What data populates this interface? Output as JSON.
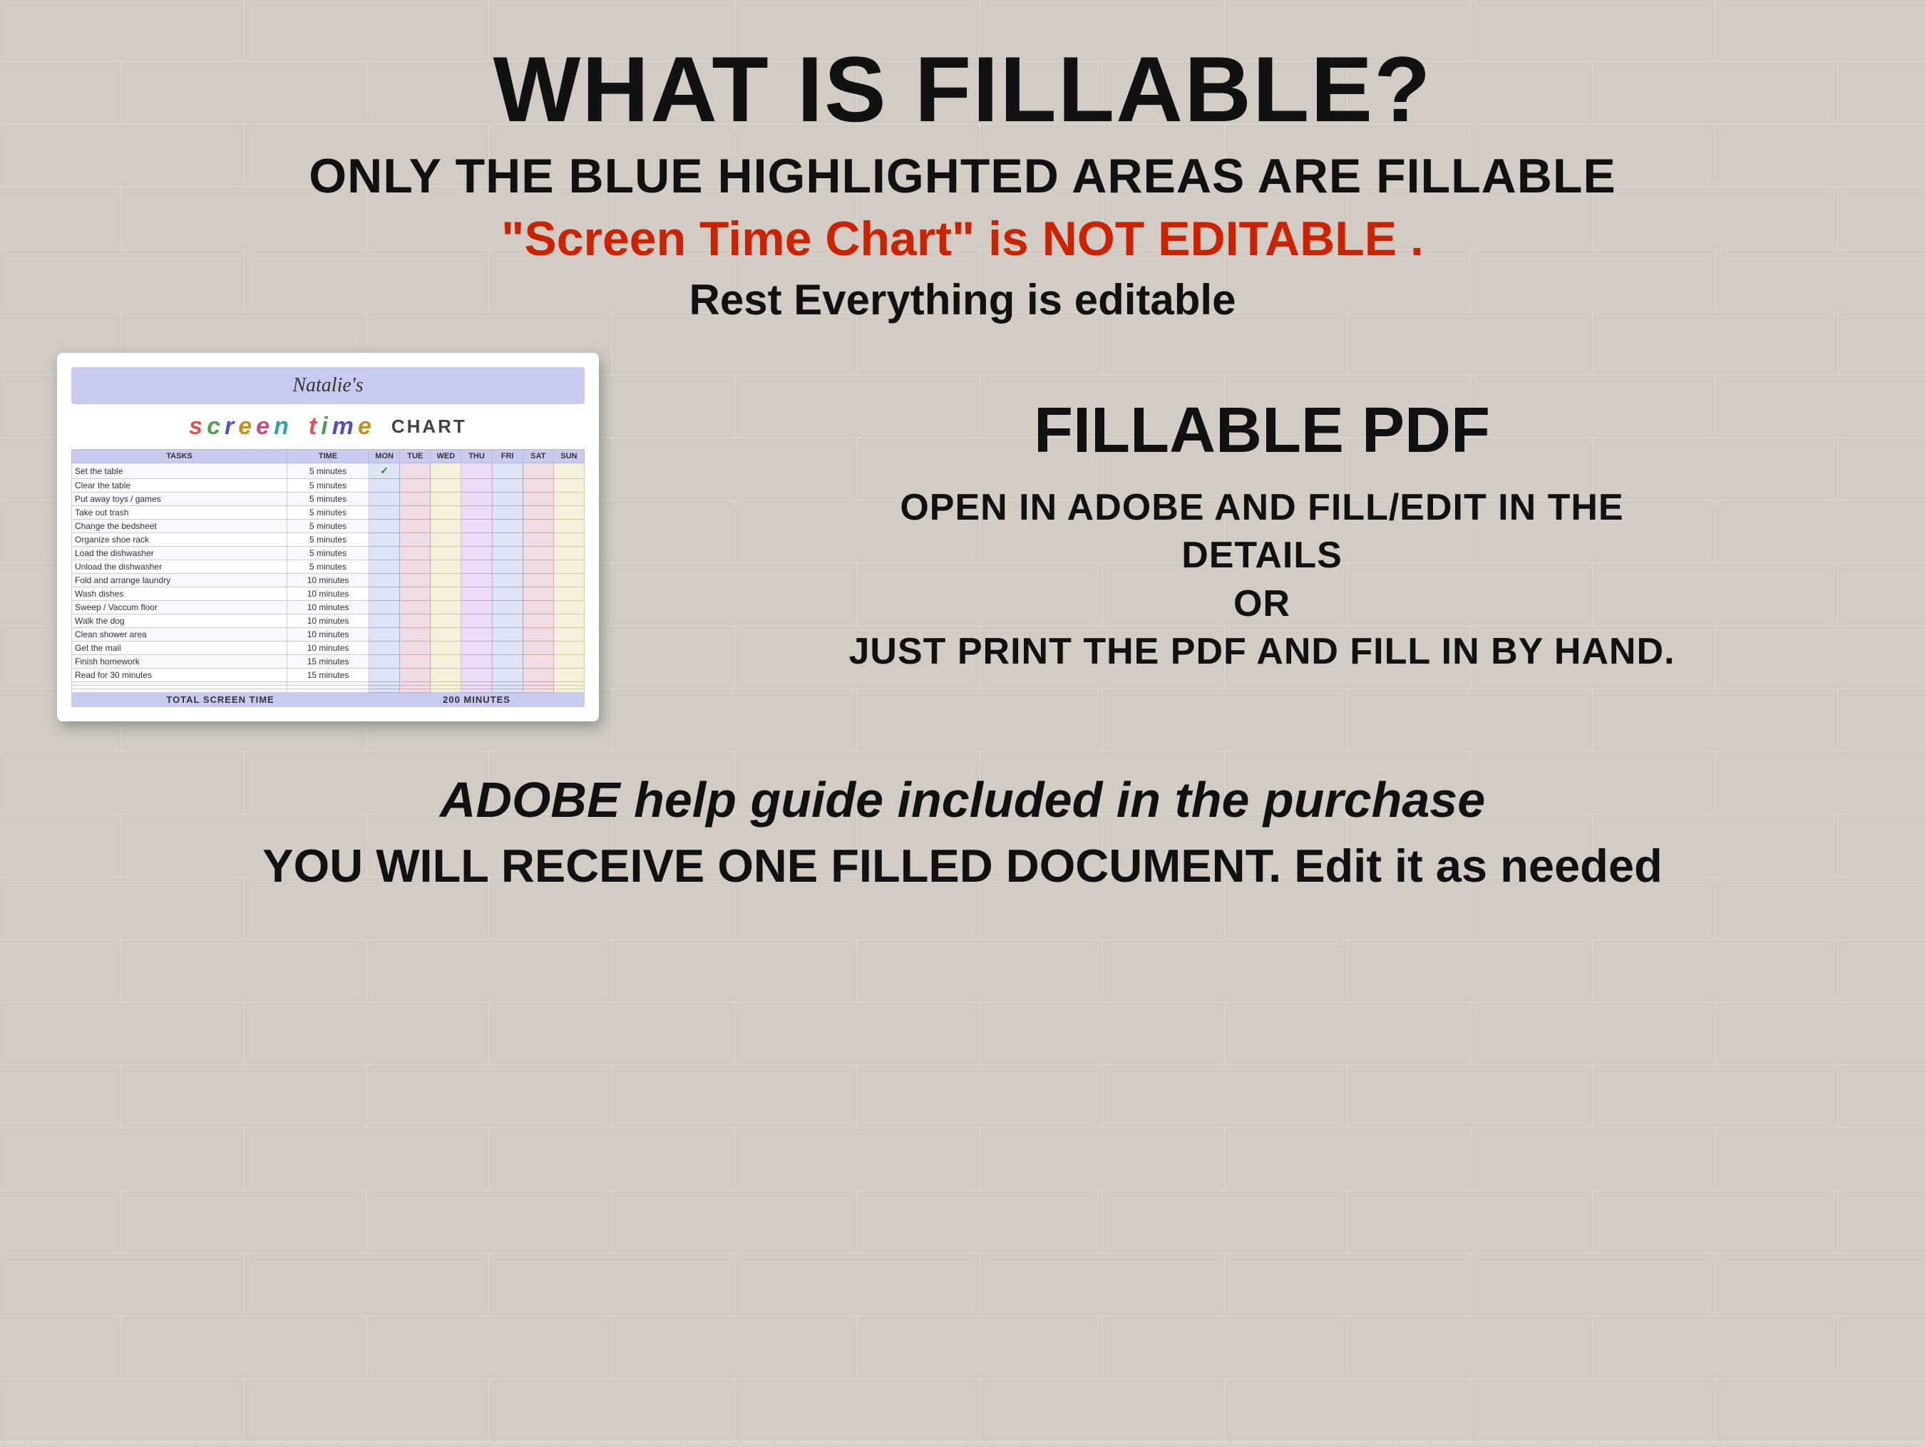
{
  "header": {
    "main_title": "WHAT IS FILLABLE?",
    "subtitle": "ONLY THE BLUE HIGHLIGHTED AREAS ARE FILLABLE",
    "red_line": "\"Screen Time Chart\" is NOT EDITABLE .",
    "black_line": "Rest Everything is editable"
  },
  "pdf_preview": {
    "name": "Natalie's",
    "title_screen": "screen",
    "title_time": "time",
    "title_chart": "CHART",
    "header_tasks": "TASKS",
    "header_time": "TIME",
    "header_days": [
      "MON",
      "TUE",
      "WED",
      "THU",
      "FRI",
      "SAT",
      "SUN"
    ],
    "tasks": [
      {
        "name": "Set the table",
        "time": "5 minutes",
        "has_check": true
      },
      {
        "name": "Clear the table",
        "time": "5 minutes",
        "has_check": false
      },
      {
        "name": "Put away toys / games",
        "time": "5 minutes",
        "has_check": false
      },
      {
        "name": "Take out trash",
        "time": "5 minutes",
        "has_check": false
      },
      {
        "name": "Change the bedsheet",
        "time": "5 minutes",
        "has_check": false
      },
      {
        "name": "Organize shoe rack",
        "time": "5 minutes",
        "has_check": false
      },
      {
        "name": "Load the dishwasher",
        "time": "5 minutes",
        "has_check": false
      },
      {
        "name": "Unload the dishwasher",
        "time": "5 minutes",
        "has_check": false
      },
      {
        "name": "Fold and arrange laundry",
        "time": "10 minutes",
        "has_check": false
      },
      {
        "name": "Wash dishes",
        "time": "10 minutes",
        "has_check": false
      },
      {
        "name": "Sweep / Vaccum floor",
        "time": "10 minutes",
        "has_check": false
      },
      {
        "name": "Walk the dog",
        "time": "10 minutes",
        "has_check": false
      },
      {
        "name": "Clean shower area",
        "time": "10 minutes",
        "has_check": false
      },
      {
        "name": "Get the mail",
        "time": "10 minutes",
        "has_check": false
      },
      {
        "name": "Finish homework",
        "time": "15 minutes",
        "has_check": false
      },
      {
        "name": "Read for 30 minutes",
        "time": "15 minutes",
        "has_check": false
      },
      {
        "name": "",
        "time": "",
        "has_check": false
      },
      {
        "name": "",
        "time": "",
        "has_check": false
      },
      {
        "name": "",
        "time": "",
        "has_check": false
      }
    ],
    "footer_label": "TOTAL SCREEN TIME",
    "footer_value": "200 MINUTES"
  },
  "right_panel": {
    "fillable_label": "FILLABLE PDF",
    "description_line1": "OPEN IN ADOBE AND FILL/EDIT IN THE",
    "description_line2": "DETAILS",
    "description_line3": "OR",
    "description_line4": "JUST PRINT THE PDF AND FILL IN BY HAND."
  },
  "bottom": {
    "line1": "ADOBE help guide included in the purchase",
    "line2": "YOU WILL RECEIVE ONE FILLED DOCUMENT. Edit it as needed"
  }
}
